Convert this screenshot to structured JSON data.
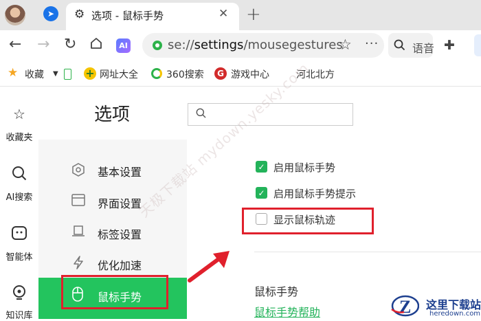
{
  "tab": {
    "title": "选项 - 鼠标手势",
    "close": "✕",
    "new_tab": "+"
  },
  "toolbar": {
    "ai_label": "AI",
    "url_prefix": "se://",
    "url_main": "settings",
    "url_suffix": "/mousegestures",
    "search_text": "语音"
  },
  "bookmarks": [
    {
      "label": "收藏",
      "icon": "star-icon",
      "color": "#f5a623"
    },
    {
      "label": "网址大全",
      "icon": "plus-circle-icon",
      "color": "#f5c400"
    },
    {
      "label": "360搜索",
      "icon": "360-search-icon",
      "color": "#2db24a"
    },
    {
      "label": "游戏中心",
      "icon": "game-icon",
      "color": "#d22b2b"
    },
    {
      "label": "河北北方",
      "icon": "",
      "color": "#333333"
    }
  ],
  "sidebar": {
    "items": [
      {
        "label": "收藏夹",
        "icon": "star-icon"
      },
      {
        "label": "AI搜索",
        "icon": "search-icon"
      },
      {
        "label": "智能体",
        "icon": "robot-icon"
      },
      {
        "label": "知识库",
        "icon": "bulb-icon"
      }
    ]
  },
  "page": {
    "title": "选项",
    "search_placeholder": ""
  },
  "nav": {
    "items": [
      {
        "label": "基本设置",
        "icon": "hexagon-icon"
      },
      {
        "label": "界面设置",
        "icon": "window-icon"
      },
      {
        "label": "标签设置",
        "icon": "tab-icon"
      },
      {
        "label": "优化加速",
        "icon": "lightning-icon"
      },
      {
        "label": "鼠标手势",
        "icon": "mouse-icon",
        "active": true
      }
    ]
  },
  "options": [
    {
      "label": "启用鼠标手势",
      "checked": true
    },
    {
      "label": "启用鼠标手势提示",
      "checked": true
    },
    {
      "label": "显示鼠标轨迹",
      "checked": false
    }
  ],
  "section": {
    "title": "鼠标手势",
    "help_link": "鼠标手势帮助"
  },
  "watermark": "天极下载站 mydown.yesky.com",
  "site_logo": {
    "name": "这里下载站",
    "domain": "heredown.com"
  },
  "colors": {
    "accent": "#23c45e",
    "highlight": "#e0202c",
    "link": "#23b35a"
  }
}
